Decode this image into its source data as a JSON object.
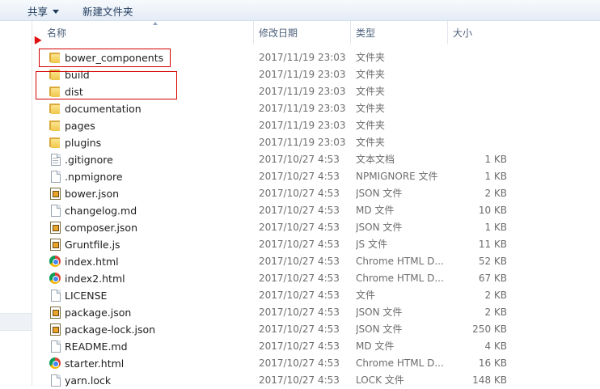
{
  "toolbar": {
    "share_label": "共享",
    "new_folder_label": "新建文件夹"
  },
  "columns": {
    "name": "名称",
    "date": "修改日期",
    "type": "类型",
    "size": "大小"
  },
  "files": [
    {
      "name": "bower_components",
      "date": "2017/11/19 23:03",
      "type": "文件夹",
      "size": "",
      "icon": "folder-icon"
    },
    {
      "name": "build",
      "date": "2017/11/19 23:03",
      "type": "文件夹",
      "size": "",
      "icon": "folder-icon"
    },
    {
      "name": "dist",
      "date": "2017/11/19 23:03",
      "type": "文件夹",
      "size": "",
      "icon": "folder-icon"
    },
    {
      "name": "documentation",
      "date": "2017/11/19 23:03",
      "type": "文件夹",
      "size": "",
      "icon": "folder-icon"
    },
    {
      "name": "pages",
      "date": "2017/11/19 23:03",
      "type": "文件夹",
      "size": "",
      "icon": "folder-icon"
    },
    {
      "name": "plugins",
      "date": "2017/11/19 23:03",
      "type": "文件夹",
      "size": "",
      "icon": "folder-icon"
    },
    {
      "name": ".gitignore",
      "date": "2017/10/27 4:53",
      "type": "文本文档",
      "size": "1 KB",
      "icon": "text-file-icon"
    },
    {
      "name": ".npmignore",
      "date": "2017/10/27 4:53",
      "type": "NPMIGNORE 文件",
      "size": "1 KB",
      "icon": "blank-file-icon"
    },
    {
      "name": "bower.json",
      "date": "2017/10/27 4:53",
      "type": "JSON 文件",
      "size": "2 KB",
      "icon": "code-file-icon"
    },
    {
      "name": "changelog.md",
      "date": "2017/10/27 4:53",
      "type": "MD 文件",
      "size": "10 KB",
      "icon": "blank-file-icon"
    },
    {
      "name": "composer.json",
      "date": "2017/10/27 4:53",
      "type": "JSON 文件",
      "size": "1 KB",
      "icon": "code-file-icon"
    },
    {
      "name": "Gruntfile.js",
      "date": "2017/10/27 4:53",
      "type": "JS 文件",
      "size": "11 KB",
      "icon": "code-file-icon"
    },
    {
      "name": "index.html",
      "date": "2017/10/27 4:53",
      "type": "Chrome HTML D...",
      "size": "52 KB",
      "icon": "chrome-icon"
    },
    {
      "name": "index2.html",
      "date": "2017/10/27 4:53",
      "type": "Chrome HTML D...",
      "size": "67 KB",
      "icon": "chrome-icon"
    },
    {
      "name": "LICENSE",
      "date": "2017/10/27 4:53",
      "type": "文件",
      "size": "2 KB",
      "icon": "blank-file-icon"
    },
    {
      "name": "package.json",
      "date": "2017/10/27 4:53",
      "type": "JSON 文件",
      "size": "2 KB",
      "icon": "code-file-icon"
    },
    {
      "name": "package-lock.json",
      "date": "2017/10/27 4:53",
      "type": "JSON 文件",
      "size": "250 KB",
      "icon": "code-file-icon"
    },
    {
      "name": "README.md",
      "date": "2017/10/27 4:53",
      "type": "MD 文件",
      "size": "4 KB",
      "icon": "blank-file-icon"
    },
    {
      "name": "starter.html",
      "date": "2017/10/27 4:53",
      "type": "Chrome HTML D...",
      "size": "16 KB",
      "icon": "chrome-icon"
    },
    {
      "name": "yarn.lock",
      "date": "2017/10/27 4:53",
      "type": "LOCK 文件",
      "size": "148 KB",
      "icon": "blank-file-icon"
    }
  ],
  "colors": {
    "annotation": "#d40000",
    "header_text": "#4c607a",
    "folder": "#f0c64a"
  }
}
